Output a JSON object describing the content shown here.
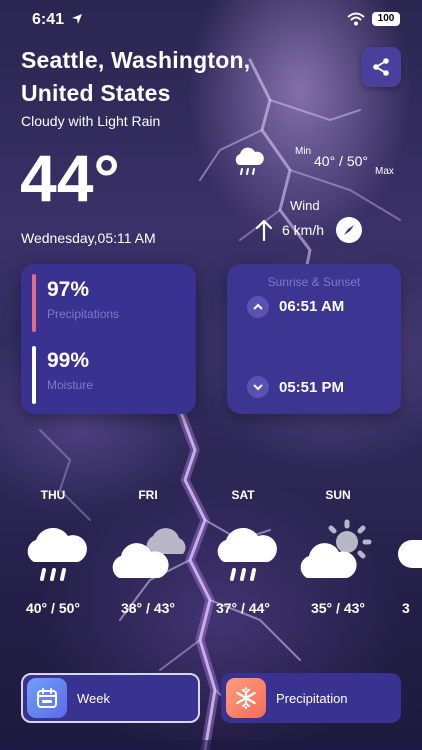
{
  "status_bar": {
    "time": "6:41",
    "battery": "100"
  },
  "location": {
    "line1": "Seattle, Washington,",
    "line2": "United States"
  },
  "condition": "Cloudy with Light Rain",
  "temperature": "44°",
  "date": "Wednesday,05:11 AM",
  "minmax": {
    "min_label": "Min",
    "value": "40° / 50°",
    "max_label": "Max"
  },
  "wind": {
    "label": "Wind",
    "value": "6 km/h"
  },
  "stats": {
    "precip_value": "97%",
    "precip_label": "Precipitations",
    "moisture_value": "99%",
    "moisture_label": "Moisture"
  },
  "sun": {
    "title": "Sunrise & Sunset",
    "sunrise": "06:51 AM",
    "sunset": "05:51 PM"
  },
  "forecast": [
    {
      "day": "THU",
      "temp": "40° / 50°",
      "icon": "cloud-rain-icon"
    },
    {
      "day": "FRI",
      "temp": "38° / 43°",
      "icon": "clouds-icon"
    },
    {
      "day": "SAT",
      "temp": "37° / 44°",
      "icon": "cloud-rain-icon"
    },
    {
      "day": "SUN",
      "temp": "35° / 43°",
      "icon": "partly-sunny-icon"
    },
    {
      "day": "",
      "temp": "3",
      "icon": "cloud-icon"
    }
  ],
  "buttons": {
    "week": "Week",
    "precipitation": "Precipitation"
  },
  "colors": {
    "card": "#3a3290",
    "precip_bar": "#e06c86",
    "accent_text": "#7e79c9"
  }
}
